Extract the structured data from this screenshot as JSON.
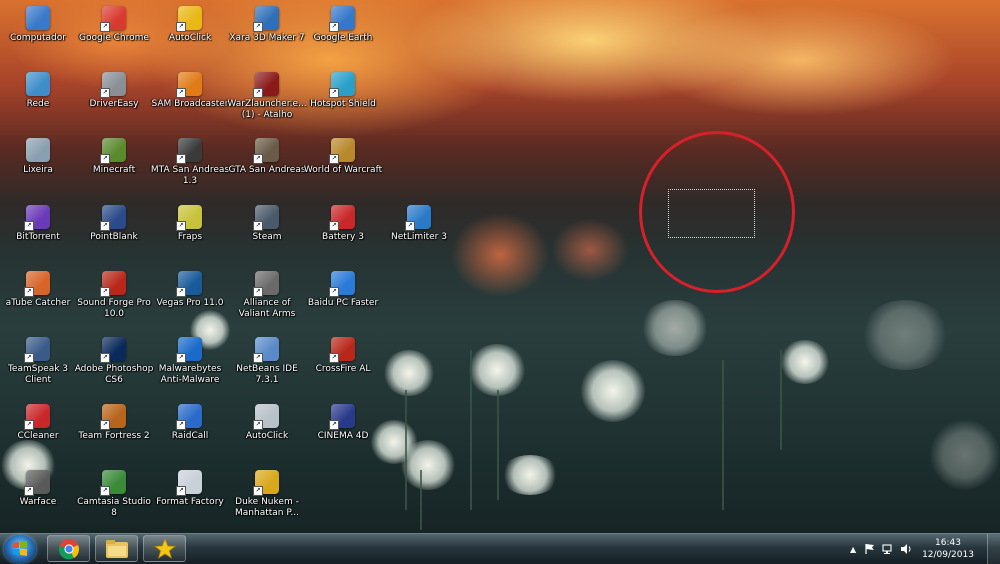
{
  "desktop": {
    "icons": [
      {
        "label": "Computador",
        "icon": "computer-icon",
        "color": "#3a78c8"
      },
      {
        "label": "Google Chrome",
        "icon": "chrome-icon",
        "color": "#d93a2f"
      },
      {
        "label": "AutoClick",
        "icon": "star-icon",
        "color": "#e8b814"
      },
      {
        "label": "Xara 3D Maker 7",
        "icon": "xara-icon",
        "color": "#2f6fb8"
      },
      {
        "label": "Google Earth",
        "icon": "globe-icon",
        "color": "#3577c9"
      },
      {
        "label": "Rede",
        "icon": "network-icon",
        "color": "#3f8ec9"
      },
      {
        "label": "DriverEasy",
        "icon": "drivereasy-icon",
        "color": "#8a8f96"
      },
      {
        "label": "SAM Broadcaster",
        "icon": "sam-broadcaster-icon",
        "color": "#e07b16"
      },
      {
        "label": "WarZlauncher.e... (1) - Atalho",
        "icon": "warz-icon",
        "color": "#8a1a1a"
      },
      {
        "label": "Hotspot Shield",
        "icon": "shield-icon",
        "color": "#2aa0c8"
      },
      {
        "label": "Lixeira",
        "icon": "recycle-bin-icon",
        "color": "#8aa0b0"
      },
      {
        "label": "Minecraft",
        "icon": "minecraft-icon",
        "color": "#5a8a2e"
      },
      {
        "label": "MTA San Andreas 1.3",
        "icon": "mta-icon",
        "color": "#3a3a3a"
      },
      {
        "label": "GTA San Andreas",
        "icon": "gta-icon",
        "color": "#6a5a48"
      },
      {
        "label": "World of Warcraft",
        "icon": "wow-icon",
        "color": "#b8892a"
      },
      {
        "label": "BitTorrent",
        "icon": "bittorrent-icon",
        "color": "#6a3ab8"
      },
      {
        "label": "PointBlank",
        "icon": "pointblank-icon",
        "color": "#2a4a8a"
      },
      {
        "label": "Fraps",
        "icon": "fraps-icon",
        "color": "#c8c23a"
      },
      {
        "label": "Steam",
        "icon": "steam-icon",
        "color": "#4a5a6a"
      },
      {
        "label": "Battery 3",
        "icon": "battery-icon",
        "color": "#c8282a"
      },
      {
        "label": "NetLimiter 3",
        "icon": "netlimiter-icon",
        "color": "#2a7ac8"
      },
      {
        "label": "aTube Catcher",
        "icon": "atube-icon",
        "color": "#d8642a"
      },
      {
        "label": "Sound Forge Pro 10.0",
        "icon": "soundforge-icon",
        "color": "#b8281a"
      },
      {
        "label": "Vegas Pro 11.0",
        "icon": "vegas-icon",
        "color": "#1a5a9a"
      },
      {
        "label": "Alliance of Valiant Arms",
        "icon": "ava-icon",
        "color": "#6a6a6a"
      },
      {
        "label": "Baidu PC Faster",
        "icon": "lightning-icon",
        "color": "#2a7ad8"
      },
      {
        "label": "TeamSpeak 3 Client",
        "icon": "teamspeak-icon",
        "color": "#3a5a8a"
      },
      {
        "label": "Adobe Photoshop CS6",
        "icon": "photoshop-icon",
        "color": "#0a2a5a"
      },
      {
        "label": "Malwarebytes Anti-Malware",
        "icon": "malwarebytes-icon",
        "color": "#1a6ac8"
      },
      {
        "label": "NetBeans IDE 7.3.1",
        "icon": "netbeans-icon",
        "color": "#5a8ac8"
      },
      {
        "label": "CrossFire AL",
        "icon": "crossfire-icon",
        "color": "#b8281a"
      },
      {
        "label": "CCleaner",
        "icon": "ccleaner-icon",
        "color": "#c8282a"
      },
      {
        "label": "Team Fortress 2",
        "icon": "tf2-icon",
        "color": "#b8641a"
      },
      {
        "label": "RaidCall",
        "icon": "raidcall-icon",
        "color": "#2a6ac8"
      },
      {
        "label": "AutoClick",
        "icon": "autoclick-file-icon",
        "color": "#b8c0c8"
      },
      {
        "label": "CINEMA 4D",
        "icon": "cinema4d-icon",
        "color": "#2a3a8a"
      },
      {
        "label": "Warface",
        "icon": "warface-icon",
        "color": "#5a5a5a"
      },
      {
        "label": "Camtasia Studio 8",
        "icon": "camtasia-icon",
        "color": "#3a8a3a"
      },
      {
        "label": "Format Factory",
        "icon": "format-factory-icon",
        "color": "#c8d0d8"
      },
      {
        "label": "Duke Nukem - Manhattan P...",
        "icon": "radiation-icon",
        "color": "#d8a81a"
      }
    ]
  },
  "taskbar": {
    "start_label": "Iniciar",
    "pinned": [
      {
        "name": "chrome-taskbar-button",
        "icon": "chrome-icon"
      },
      {
        "name": "explorer-taskbar-button",
        "icon": "folder-icon"
      },
      {
        "name": "autoclick-taskbar-button",
        "icon": "star-icon"
      }
    ],
    "tray": {
      "show_hidden": "▲",
      "time": "16:43",
      "date": "12/09/2013"
    }
  },
  "colors": {
    "annotation_circle": "#d8202a",
    "taskbar": "#1e2c33"
  }
}
